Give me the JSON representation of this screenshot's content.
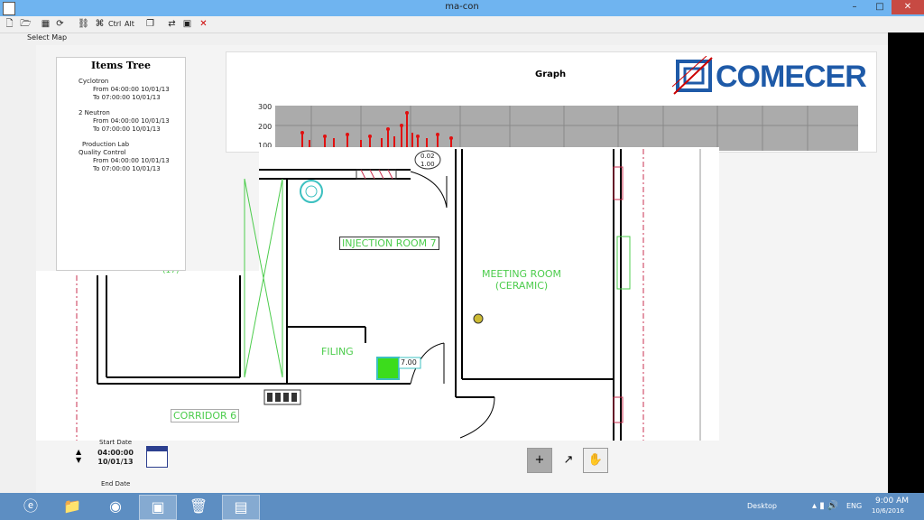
{
  "window": {
    "title": "ma-con",
    "min": "–",
    "max": "□",
    "close": "✕"
  },
  "toolbar": {
    "ctrl": "Ctrl",
    "alt": "Alt"
  },
  "menu": {
    "select_map": "Select Map"
  },
  "items_tree": {
    "header": "Items Tree",
    "rows": [
      "Cyclotron",
      "From 04:00:00  10/01/13",
      "To     07:00:00  10/01/13",
      "2 Neutron",
      "From 04:00:00  10/01/13",
      "To     07:00:00  10/01/13",
      "Production Lab",
      "Quality Control",
      "From 04:00:00  10/01/13",
      "To     07:00:00  10/01/13"
    ]
  },
  "graph": {
    "title": "Graph",
    "logo_text": "COMECER",
    "yticks": [
      "300",
      "200",
      "100"
    ]
  },
  "floor_plan": {
    "injection_room": "INJECTION ROOM 7",
    "meeting_room_1": "MEETING ROOM",
    "meeting_room_2": "(CERAMIC)",
    "filing": "FILING",
    "corridor": "CORRIDOR 6",
    "sensor_value": "7.00",
    "door_value_1": "0.02",
    "door_value_2": "1.00",
    "left_value": "(17)"
  },
  "dates": {
    "start_label": "Start Date",
    "start_time": "04:00:00",
    "start_day": "10/01/13",
    "end_label": "End Date"
  },
  "tools": {
    "pointer": "+",
    "arrow": "↗",
    "hand": "✋"
  },
  "taskbar": {
    "desktop": "Desktop",
    "lang": "ENG",
    "time": "9:00 AM",
    "date": "10/6/2016"
  },
  "colors": {
    "accent_green": "#4ccc4c",
    "brand_blue": "#1e5aa8",
    "taskbar": "#5d8ec2",
    "titlebar": "#6fb4f0"
  }
}
